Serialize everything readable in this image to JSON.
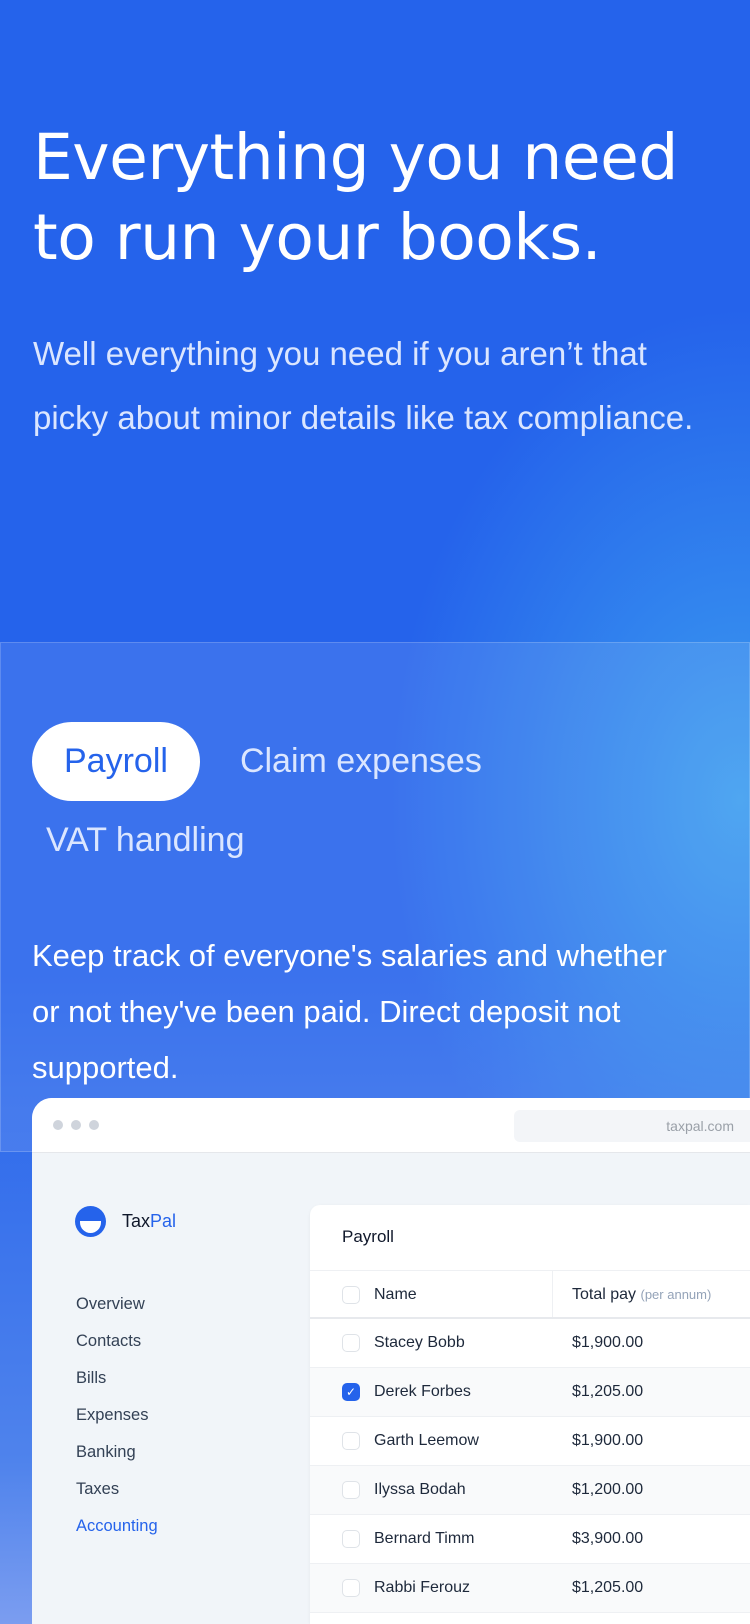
{
  "hero": {
    "title": "Everything you need to run your books.",
    "subtitle": "Well everything you need if you aren’t that picky about minor details like tax compliance."
  },
  "tabs": [
    {
      "label": "Payroll",
      "active": true
    },
    {
      "label": "Claim expenses"
    },
    {
      "label": "VAT handling"
    }
  ],
  "description": "Keep track of everyone's salaries and whether or not they've been paid. Direct deposit not supported.",
  "app": {
    "url": "taxpal.com",
    "logo": {
      "prefix": "Tax",
      "suffix": "Pal"
    },
    "nav": [
      "Overview",
      "Contacts",
      "Bills",
      "Expenses",
      "Banking",
      "Taxes",
      "Accounting"
    ],
    "nav_active": "Accounting",
    "card_title": "Payroll",
    "columns": {
      "name": "Name",
      "pay": "Total pay",
      "pay_note": "(per annum)"
    },
    "rows": [
      {
        "name": "Stacey Bobb",
        "pay": "$1,900.00",
        "checked": false
      },
      {
        "name": "Derek Forbes",
        "pay": "$1,205.00",
        "checked": true
      },
      {
        "name": "Garth Leemow",
        "pay": "$1,900.00",
        "checked": false
      },
      {
        "name": "Ilyssa Bodah",
        "pay": "$1,200.00",
        "checked": false
      },
      {
        "name": "Bernard Timm",
        "pay": "$3,900.00",
        "checked": false
      },
      {
        "name": "Rabbi Ferouz",
        "pay": "$1,205.00",
        "checked": false
      }
    ]
  },
  "colors": {
    "accent": "#2563eb"
  }
}
